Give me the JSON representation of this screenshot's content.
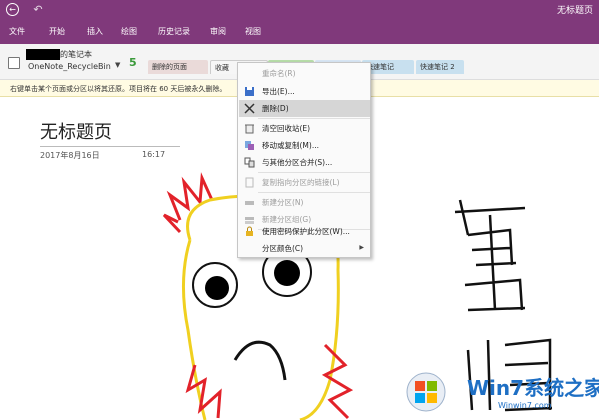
{
  "window": {
    "title": "无标题页",
    "back": "←",
    "undo": "↶"
  },
  "ribbon": {
    "tabs": [
      "文件",
      "开始",
      "插入",
      "绘图",
      "历史记录",
      "审阅",
      "视图"
    ]
  },
  "notebook": {
    "name_suffix": "的笔记本",
    "section_group": "OneNote_RecycleBin",
    "count": "5",
    "tabs": [
      "删除的页面",
      "收藏",
      "",
      "",
      "快速笔记",
      "快速笔记 2"
    ]
  },
  "infobar": {
    "text": "右键单击某个页面或分区以将其还原。项目将在 60 天后被永久删除。"
  },
  "page": {
    "title": "无标题页",
    "date": "2017年8月16日",
    "time": "16:17"
  },
  "context_menu": {
    "items": [
      {
        "label": "重命名(R)",
        "disabled": true,
        "icon": "rename-icon"
      },
      {
        "label": "导出(E)...",
        "disabled": false,
        "icon": "export-icon"
      },
      {
        "label": "删除(D)",
        "disabled": false,
        "icon": "delete-icon",
        "highlighted": true
      },
      {
        "label": "清空回收站(E)",
        "disabled": false,
        "icon": "recycle-bin-icon"
      },
      {
        "label": "移动或复制(M)...",
        "disabled": false,
        "icon": "move-copy-icon"
      },
      {
        "label": "与其他分区合并(S)...",
        "disabled": false,
        "icon": "merge-icon"
      },
      {
        "label": "复制指向分区的链接(L)",
        "disabled": true,
        "icon": "link-icon"
      },
      {
        "label": "新建分区(N)",
        "disabled": true,
        "icon": "new-section-icon"
      },
      {
        "label": "新建分区组(G)",
        "disabled": true,
        "icon": "new-section-group-icon"
      },
      {
        "label": "使用密码保护此分区(W)...",
        "disabled": false,
        "icon": "lock-icon"
      },
      {
        "label": "分区颜色(C)",
        "disabled": false,
        "icon": "color-icon",
        "submenu": true
      }
    ]
  },
  "watermark": {
    "brand": "Win7系统之家",
    "url": "Winwin7.com"
  },
  "colors": {
    "accent": "#80397b",
    "infobar": "#fffbe3",
    "highlight": "#d6d6d6"
  }
}
